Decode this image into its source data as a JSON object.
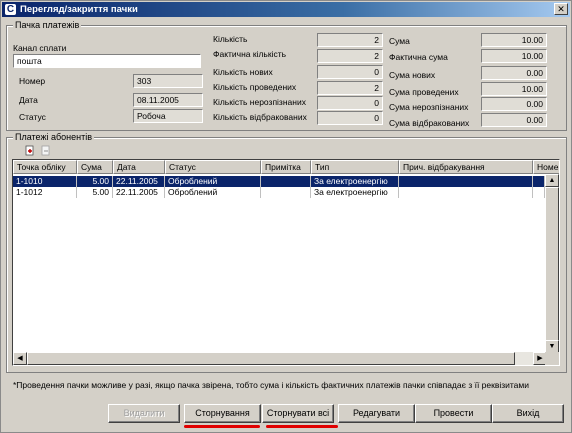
{
  "window": {
    "title": "Перегляд/закриття пачки",
    "app_icon": "С"
  },
  "batch": {
    "legend": "Пачка платежів",
    "channel_label": "Канал сплати",
    "channel_value": "пошта",
    "number_label": "Номер",
    "number_value": "303",
    "date_label": "Дата",
    "date_value": "08.11.2005",
    "status_label": "Статус",
    "status_value": "Робоча",
    "counts": [
      {
        "label": "Кількість",
        "value": "2"
      },
      {
        "label": "Фактична кількість",
        "value": "2"
      },
      {
        "label": "Кількість нових",
        "value": "0"
      },
      {
        "label": "Кількість проведених",
        "value": "2"
      },
      {
        "label": "Кількість нерозпізнаних",
        "value": "0"
      },
      {
        "label": "Кількість відбракованих",
        "value": "0"
      }
    ],
    "sums": [
      {
        "label": "Сума",
        "value": "10.00"
      },
      {
        "label": "Фактична сума",
        "value": "10.00"
      },
      {
        "label": "Сума нових",
        "value": "0.00"
      },
      {
        "label": "Сума проведених",
        "value": "10.00"
      },
      {
        "label": "Сума нерозпізнаних",
        "value": "0.00"
      },
      {
        "label": "Сума відбракованих",
        "value": "0.00"
      }
    ]
  },
  "payments": {
    "legend": "Платежі абонентів",
    "columns": [
      "Точка обліку",
      "Сума",
      "Дата",
      "Статус",
      "Примітка",
      "Тип",
      "Прич. відбракування",
      "Номе"
    ],
    "rows": [
      [
        "1-1010",
        "5.00",
        "22.11.2005",
        "Оброблений",
        "",
        "За електроенергію",
        "",
        ""
      ],
      [
        "1-1012",
        "5.00",
        "22.11.2005",
        "Оброблений",
        "",
        "За електроенергію",
        "",
        ""
      ]
    ],
    "selected_row": 0
  },
  "note": "*Проведення пачки можливе у разі, якщо пачка звірена, тобто сума і кількість фактичних платежів пачки співпадає з її реквізитами",
  "buttons": {
    "delete": "Видалити",
    "reverse": "Сторнування",
    "reverse_all": "Сторнувати всі",
    "edit": "Редагувати",
    "post": "Провести",
    "exit": "Вихід"
  },
  "colors": {
    "highlight_underline": "#e00000",
    "selection": "#0a246a"
  }
}
